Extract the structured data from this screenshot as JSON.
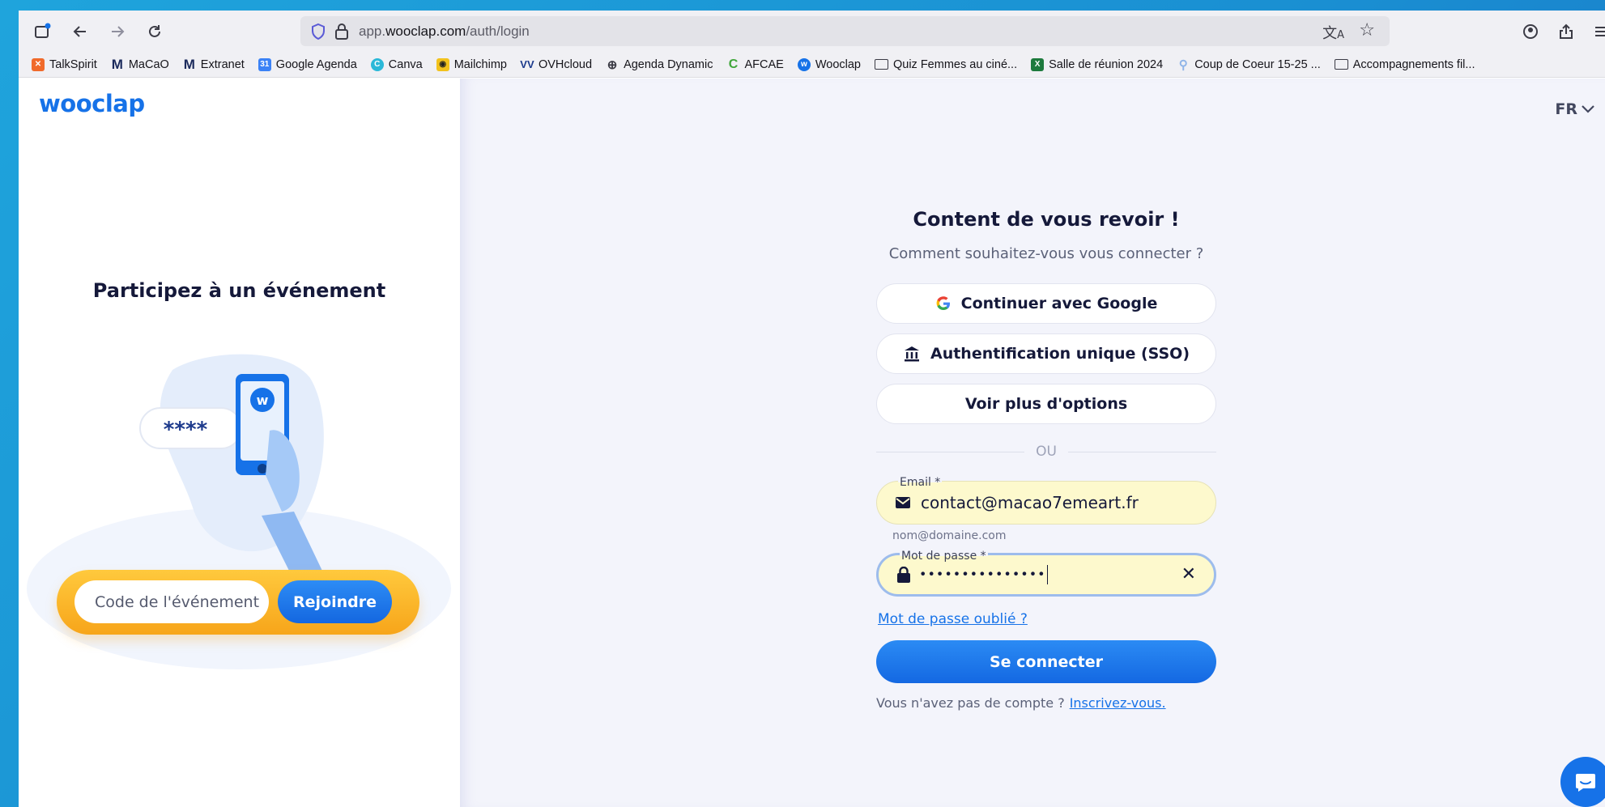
{
  "browser": {
    "url_prefix": "app.",
    "url_domain": "wooclap.com",
    "url_path": "/auth/login",
    "bookmarks": [
      {
        "label": "TalkSpirit",
        "icon": "talkspirit-icon",
        "color": "#f06a2b"
      },
      {
        "label": "MaCaO",
        "icon": "macao-icon",
        "color": "#1b2a5c"
      },
      {
        "label": "Extranet",
        "icon": "macao-icon",
        "color": "#1b2a5c"
      },
      {
        "label": "Google Agenda",
        "icon": "calendar-icon",
        "color": "#3b82f6"
      },
      {
        "label": "Canva",
        "icon": "canva-icon",
        "color": "#2bb8d8"
      },
      {
        "label": "Mailchimp",
        "icon": "mailchimp-icon",
        "color": "#f2c21c"
      },
      {
        "label": "OVHcloud",
        "icon": "ovh-icon",
        "color": "#1b3a8c"
      },
      {
        "label": "Agenda Dynamic",
        "icon": "globe-icon",
        "color": ""
      },
      {
        "label": "AFCAE",
        "icon": "afcae-icon",
        "color": "#3fa63a"
      },
      {
        "label": "Wooclap",
        "icon": "wooclap-icon",
        "color": "#1672e8"
      },
      {
        "label": "Quiz Femmes au ciné...",
        "icon": "folder-icon",
        "color": ""
      },
      {
        "label": "Salle de réunion 2024",
        "icon": "excel-icon",
        "color": "#1d7a3d"
      },
      {
        "label": "Coup de Coeur 15-25 ...",
        "icon": "bookmark-icon",
        "color": "#8fb4e8"
      },
      {
        "label": "Accompagnements fil...",
        "icon": "folder-icon",
        "color": ""
      }
    ]
  },
  "left": {
    "logo": "wooclap",
    "title": "Participez à un événement",
    "illus_code": "****",
    "illus_badge": "w",
    "code_placeholder": "Code de l'événement",
    "join_label": "Rejoindre"
  },
  "lang": "FR",
  "login": {
    "title": "Content de vous revoir !",
    "subtitle": "Comment souhaitez-vous vous connecter ?",
    "google_label": "Continuer avec Google",
    "sso_label": "Authentification unique (SSO)",
    "more_label": "Voir plus d'options",
    "divider": "OU",
    "email_label": "Email *",
    "email_value": "contact@macao7emeart.fr",
    "email_hint": "nom@domaine.com",
    "password_label": "Mot de passe *",
    "password_value": "•••••••••••••••",
    "forgot": "Mot de passe oublié ?",
    "connect": "Se connecter",
    "no_account": "Vous n'avez pas de compte ?",
    "signup": "Inscrivez-vous."
  },
  "colors": {
    "brand": "#1672e8",
    "accent_yellow": "#f7a51a",
    "autofill": "#fdf9cd"
  }
}
